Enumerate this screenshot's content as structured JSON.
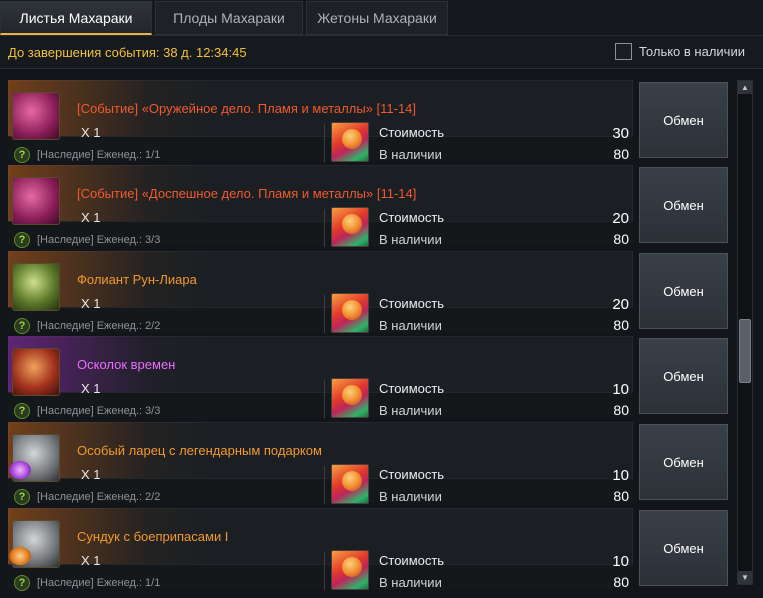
{
  "tabs": [
    {
      "label": "Листья Махараки",
      "active": true
    },
    {
      "label": "Плоды Махараки",
      "active": false
    },
    {
      "label": "Жетоны Махараки",
      "active": false
    }
  ],
  "event": {
    "timer_text": "До завершения события: 38 д. 12:34:45",
    "only_stock_label": "Только в наличии",
    "only_stock_checked": false
  },
  "labels": {
    "cost": "Стоимость",
    "stock": "В наличии",
    "exchange": "Обмен"
  },
  "items": [
    {
      "name": "[Событие] «Оружейное дело. Пламя и металлы» [11-14]",
      "qty": "X 1",
      "limit": "[Наследие] Еженед.: 1/1",
      "cost": "30",
      "stock": "80",
      "icon": "book-icon",
      "rarity": "event"
    },
    {
      "name": "[Событие] «Доспешное дело. Пламя и металлы» [11-14]",
      "qty": "X 1",
      "limit": "[Наследие] Еженед.: 3/3",
      "cost": "20",
      "stock": "80",
      "icon": "book-icon",
      "rarity": "event"
    },
    {
      "name": "Фолиант Рун-Лиара",
      "qty": "X 1",
      "limit": "[Наследие] Еженед.: 2/2",
      "cost": "20",
      "stock": "80",
      "icon": "tome-icon",
      "rarity": "legendary"
    },
    {
      "name": "Осколок времен",
      "qty": "X 1",
      "limit": "[Наследие] Еженед.: 3/3",
      "cost": "10",
      "stock": "80",
      "icon": "shard-book-icon",
      "rarity": "epic"
    },
    {
      "name": "Особый ларец с легендарным подарком",
      "qty": "X 1",
      "limit": "[Наследие] Еженед.: 2/2",
      "cost": "10",
      "stock": "80",
      "icon": "chest-icon",
      "rarity": "legendary"
    },
    {
      "name": "Сундук с боеприпасами I",
      "qty": "X 1",
      "limit": "[Наследие] Еженед.: 1/1",
      "cost": "10",
      "stock": "80",
      "icon": "ammo-chest-icon",
      "rarity": "legendary"
    }
  ],
  "colors": {
    "accent": "#e7b447",
    "timer": "#f0c23c",
    "event_item": "#f05a2e",
    "legendary_item": "#f29a2e",
    "epic_item": "#e86fff"
  }
}
